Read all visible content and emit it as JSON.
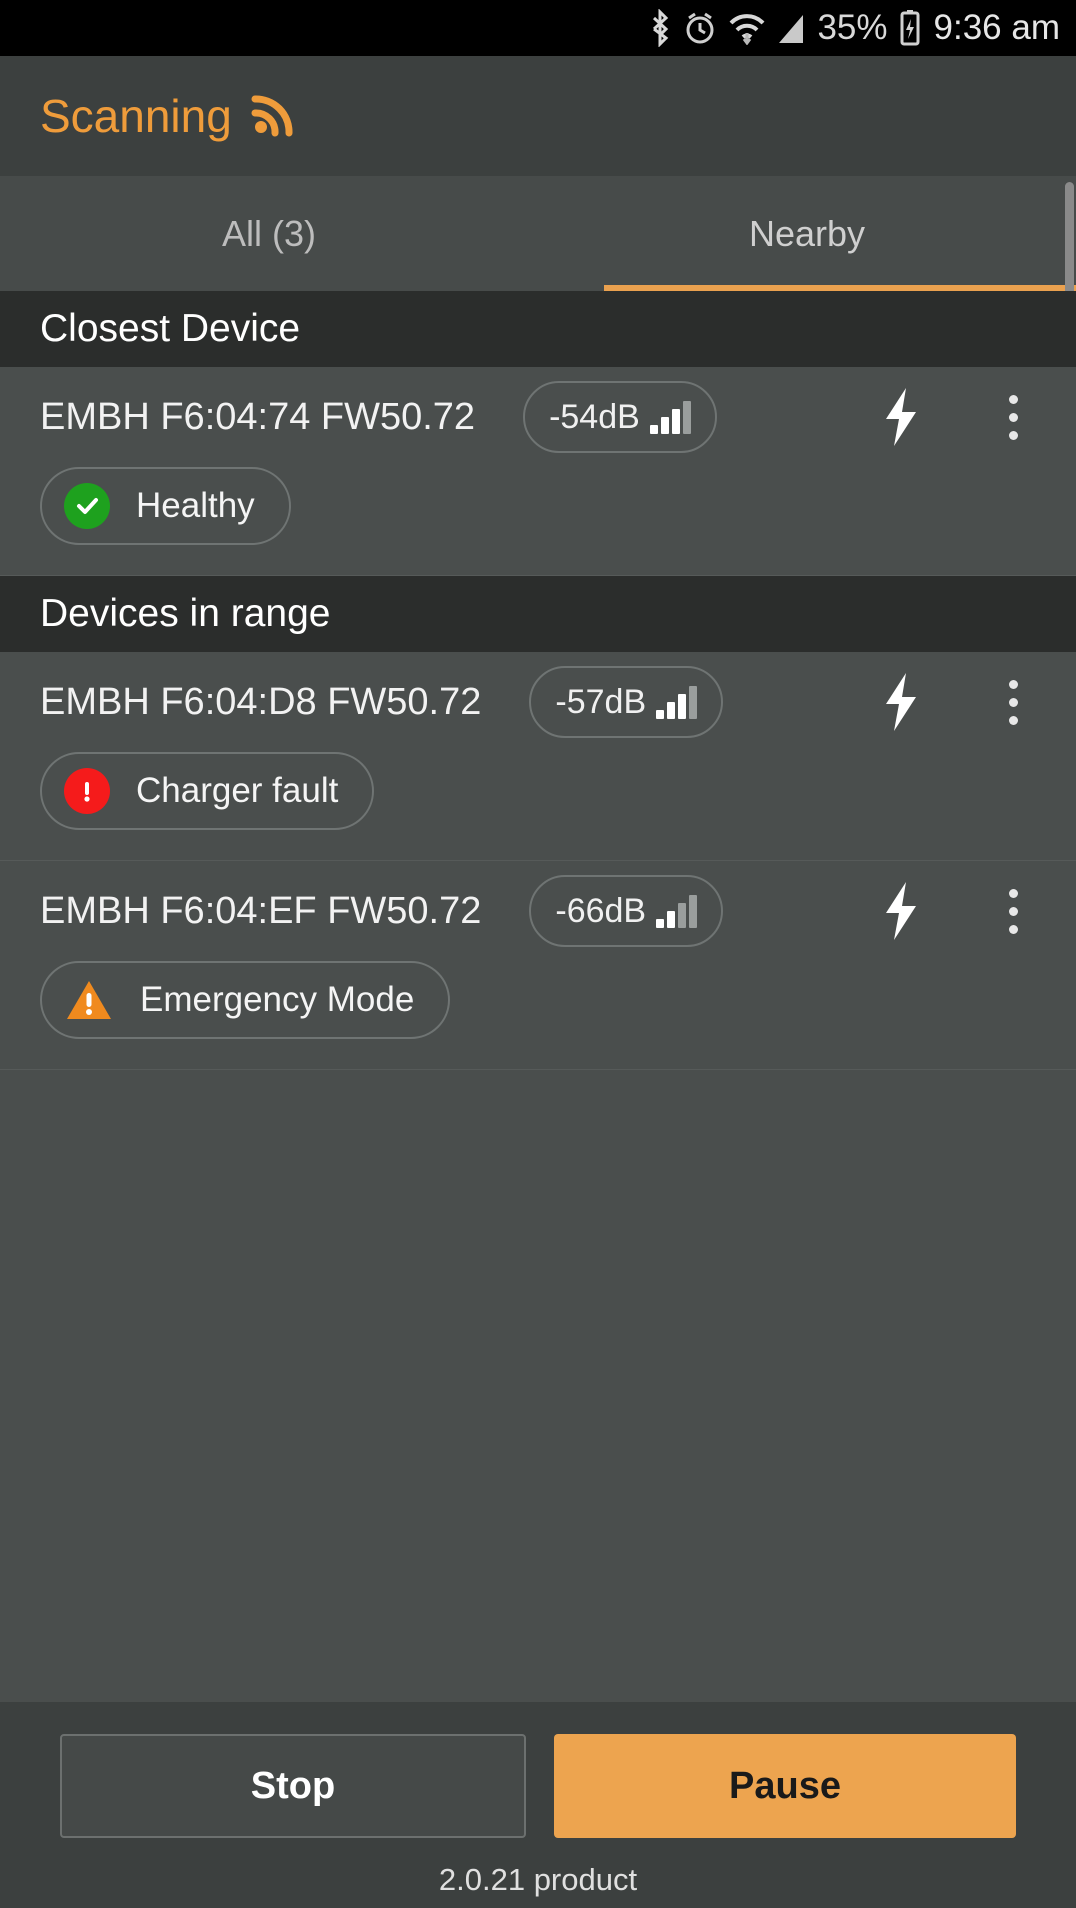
{
  "status_bar": {
    "battery_percent": "35%",
    "time": "9:36 am",
    "icons": [
      "bluetooth-icon",
      "alarm-icon",
      "wifi-icon",
      "cellular-signal-icon",
      "battery-charging-icon"
    ]
  },
  "app_bar": {
    "title": "Scanning",
    "icon": "broadcast-signal-icon"
  },
  "tabs": [
    {
      "label": "All (3)",
      "active": false
    },
    {
      "label": "Nearby",
      "active": true
    }
  ],
  "sections": [
    {
      "header": "Closest Device",
      "devices": [
        {
          "name": "EMBH F6:04:74 FW50.72",
          "rssi": "-54dB",
          "signal_bars_filled": 3,
          "signal_bars_total": 4,
          "bolt_icon": "lightning-bolt-icon",
          "menu_icon": "overflow-menu-icon",
          "status_label": "Healthy",
          "status_icon": "check-circle-icon",
          "status_color": "#1ea11e"
        }
      ]
    },
    {
      "header": "Devices in range",
      "devices": [
        {
          "name": "EMBH F6:04:D8 FW50.72",
          "rssi": "-57dB",
          "signal_bars_filled": 3,
          "signal_bars_total": 4,
          "bolt_icon": "lightning-bolt-icon",
          "menu_icon": "overflow-menu-icon",
          "status_label": "Charger fault",
          "status_icon": "error-circle-icon",
          "status_color": "#f51b1b"
        },
        {
          "name": "EMBH F6:04:EF FW50.72",
          "rssi": "-66dB",
          "signal_bars_filled": 2,
          "signal_bars_total": 4,
          "bolt_icon": "lightning-bolt-icon",
          "menu_icon": "overflow-menu-icon",
          "status_label": "Emergency Mode",
          "status_icon": "warning-triangle-icon",
          "status_color": "#f08a1e"
        }
      ]
    }
  ],
  "footer": {
    "stop_label": "Stop",
    "pause_label": "Pause",
    "version": "2.0.21 product"
  },
  "colors": {
    "accent": "#eda44f",
    "title": "#ef9c3b",
    "background": "#4a4e4d",
    "header_band": "#2b2d2c",
    "healthy": "#1ea11e",
    "fault": "#f51b1b",
    "emergency": "#f08a1e"
  }
}
